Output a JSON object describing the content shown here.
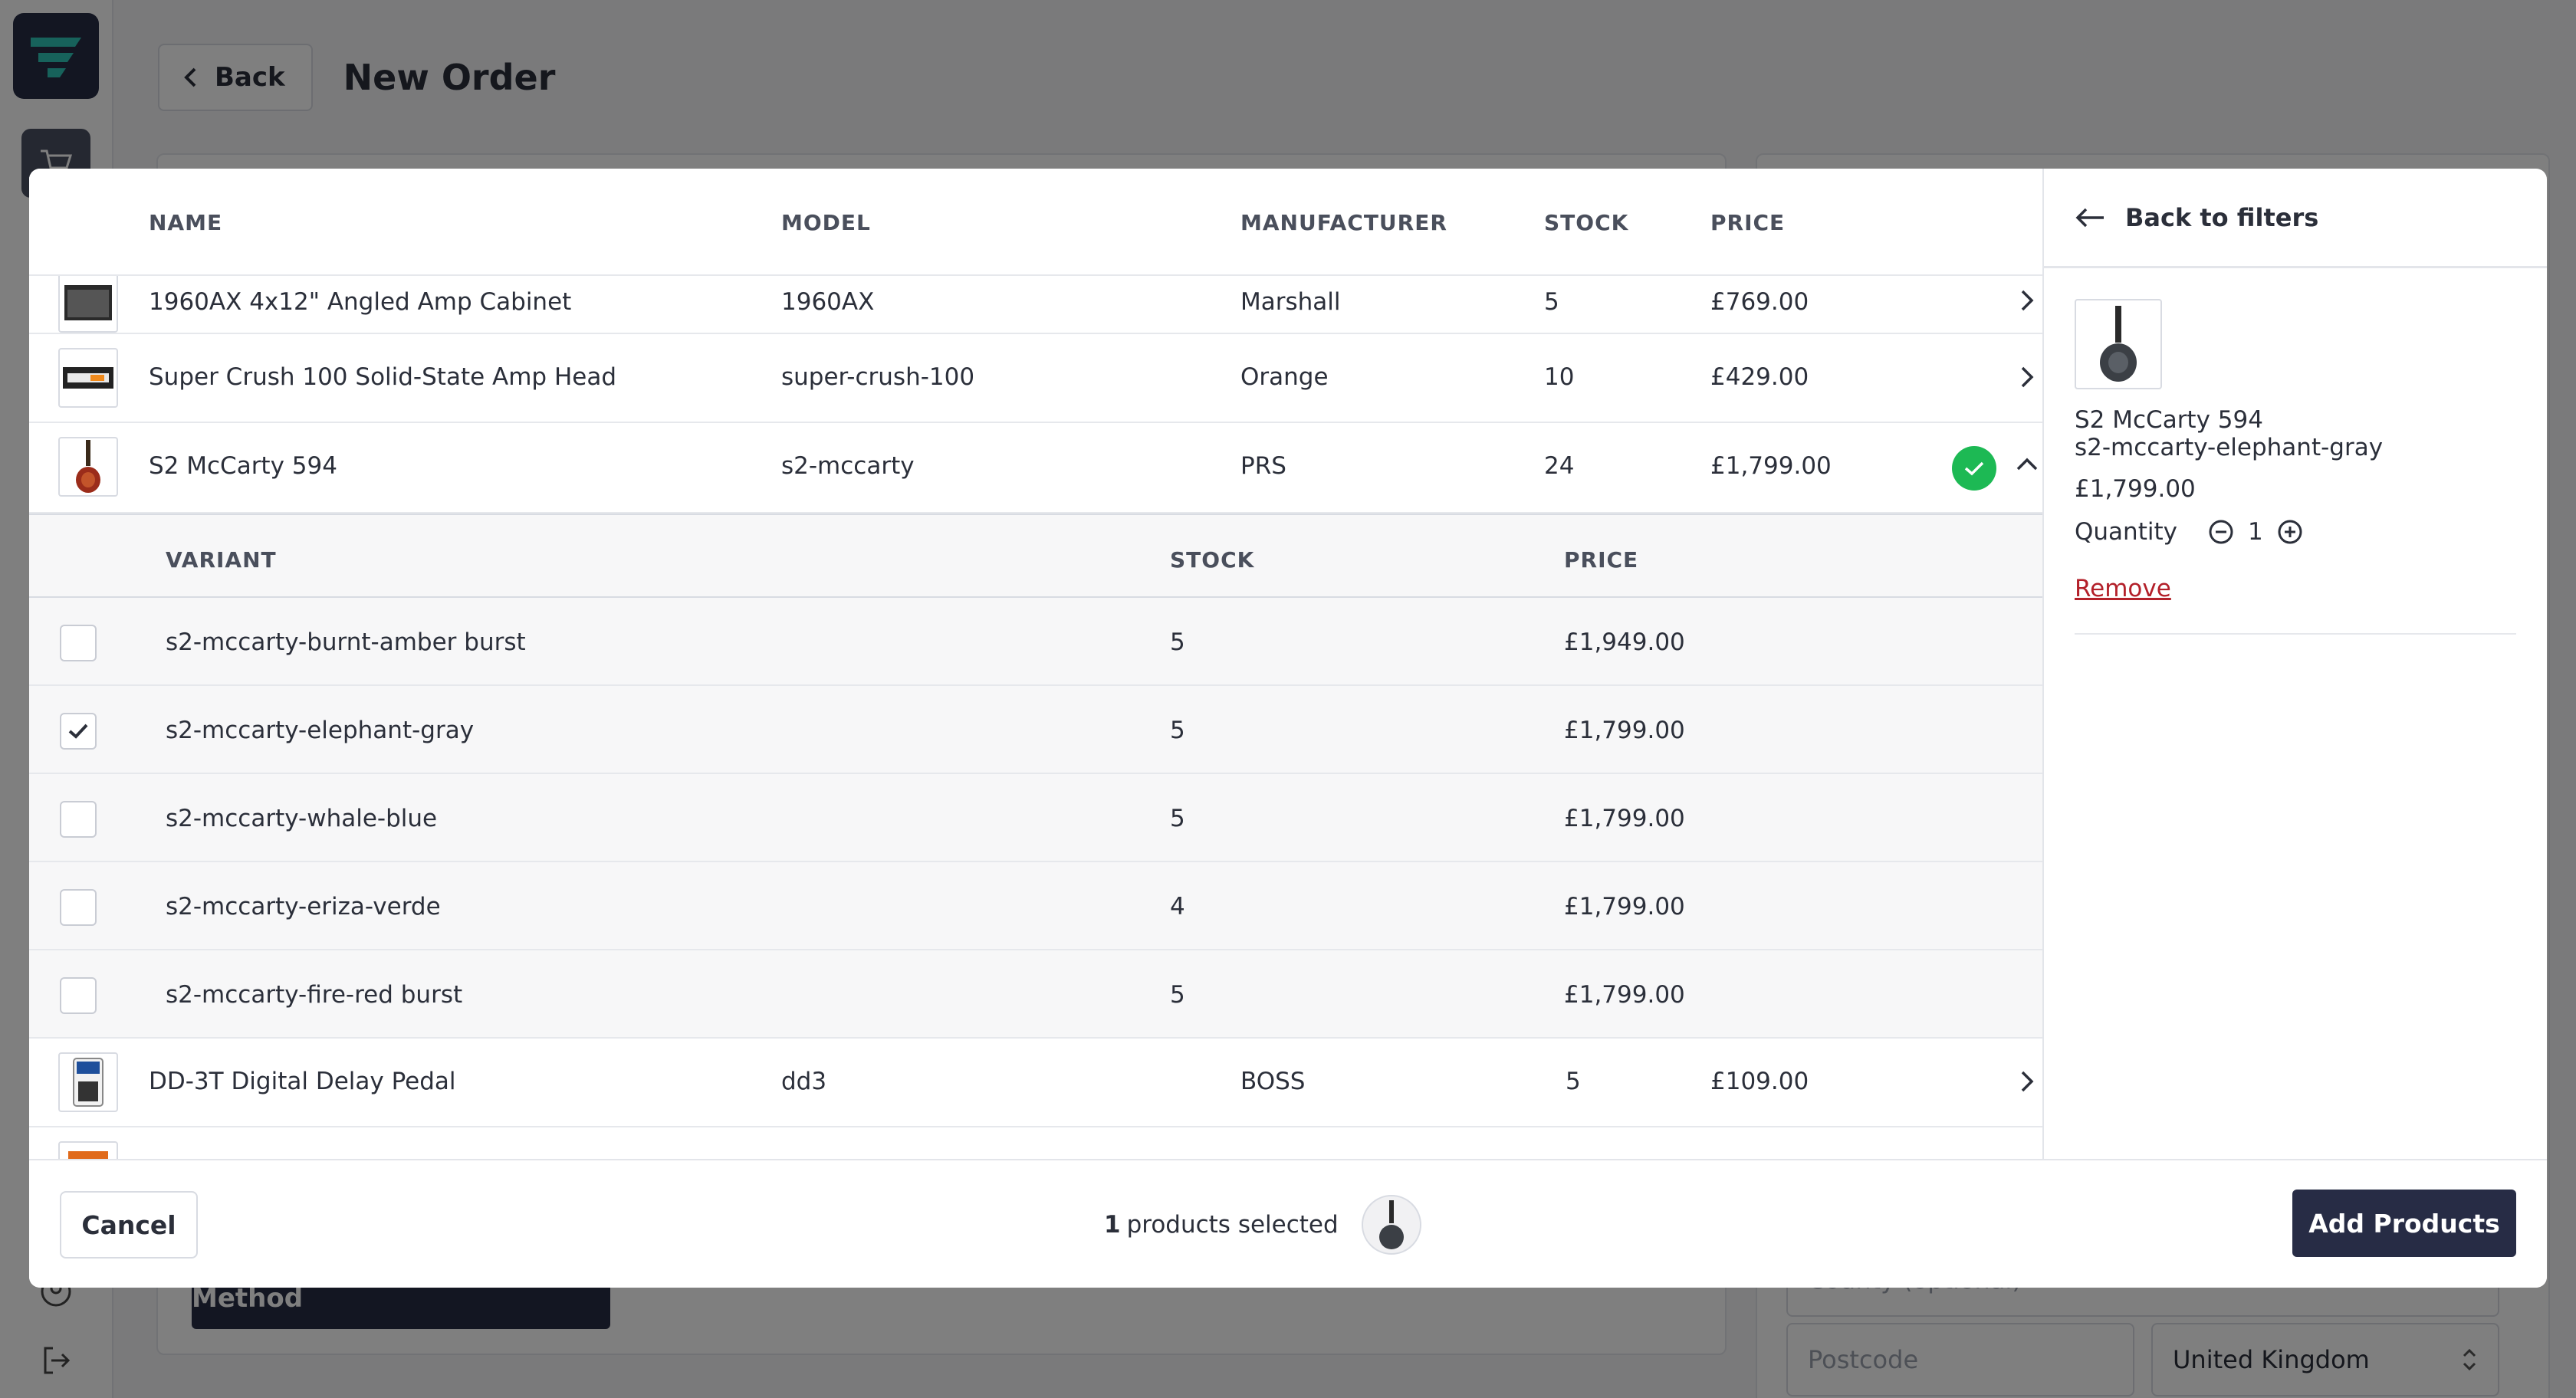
{
  "page": {
    "back_label": "Back",
    "title": "New Order",
    "continue_label": "Continue to Shipping Method",
    "county_placeholder": "County (optional)",
    "postcode_placeholder": "Postcode",
    "country_value": "United Kingdom"
  },
  "table": {
    "headers": {
      "name": "NAME",
      "model": "MODEL",
      "manufacturer": "MANUFACTURER",
      "stock": "STOCK",
      "price": "PRICE"
    },
    "rows": [
      {
        "name": "1960AX 4x12\" Angled Amp Cabinet",
        "model": "1960AX",
        "manufacturer": "Marshall",
        "stock": "5",
        "price": "£769.00"
      },
      {
        "name": "Super Crush 100 Solid-State Amp Head",
        "model": "super-crush-100",
        "manufacturer": "Orange",
        "stock": "10",
        "price": "£429.00"
      },
      {
        "name": "S2 McCarty 594",
        "model": "s2-mccarty",
        "manufacturer": "PRS",
        "stock": "24",
        "price": "£1,799.00"
      },
      {
        "name": "DD-3T Digital Delay Pedal",
        "model": "dd3",
        "manufacturer": "BOSS",
        "stock": "5",
        "price": "£109.00"
      }
    ]
  },
  "variants": {
    "headers": {
      "variant": "VARIANT",
      "stock": "STOCK",
      "price": "PRICE"
    },
    "rows": [
      {
        "name": "s2-mccarty-burnt-amber burst",
        "stock": "5",
        "price": "£1,949.00",
        "checked": false
      },
      {
        "name": "s2-mccarty-elephant-gray",
        "stock": "5",
        "price": "£1,799.00",
        "checked": true
      },
      {
        "name": "s2-mccarty-whale-blue",
        "stock": "5",
        "price": "£1,799.00",
        "checked": false
      },
      {
        "name": "s2-mccarty-eriza-verde",
        "stock": "4",
        "price": "£1,799.00",
        "checked": false
      },
      {
        "name": "s2-mccarty-fire-red burst",
        "stock": "5",
        "price": "£1,799.00",
        "checked": false
      }
    ]
  },
  "side": {
    "back_label": "Back to filters",
    "product_name": "S2 McCarty 594",
    "variant_name": "s2-mccarty-elephant-gray",
    "price": "£1,799.00",
    "quantity_label": "Quantity",
    "quantity_value": "1",
    "remove_label": "Remove"
  },
  "footer": {
    "cancel_label": "Cancel",
    "selected_count": "1",
    "selected_text": "products selected",
    "add_label": "Add Products"
  },
  "colors": {
    "primary": "#272c45",
    "success": "#1db954",
    "danger": "#b3202a"
  }
}
